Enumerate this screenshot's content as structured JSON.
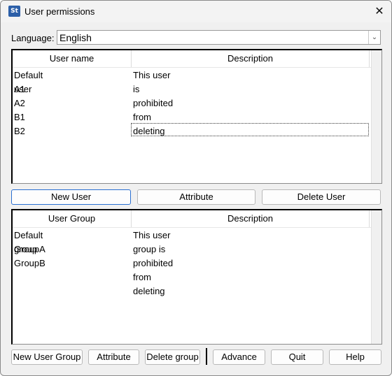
{
  "window": {
    "title": "User permissions",
    "icon_text": "St"
  },
  "language": {
    "label": "Language:",
    "value": "English"
  },
  "users": {
    "columns": [
      "User name",
      "Description"
    ],
    "rows": [
      {
        "name": "Default user",
        "description": "This user is prohibited from deleting"
      },
      {
        "name": "A1",
        "description": ""
      },
      {
        "name": "A2",
        "description": ""
      },
      {
        "name": "B1",
        "description": ""
      },
      {
        "name": "B2",
        "description": ""
      }
    ]
  },
  "user_buttons": {
    "new_user": "New User",
    "attribute": "Attribute",
    "delete_user": "Delete User"
  },
  "groups": {
    "columns": [
      "User Group",
      "Description"
    ],
    "rows": [
      {
        "name": "Default group",
        "description": "This user group is prohibited from deleting"
      },
      {
        "name": "GroupA",
        "description": ""
      },
      {
        "name": "GroupB",
        "description": ""
      }
    ]
  },
  "bottom_buttons": {
    "new_user_group": "New User Group",
    "attribute": "Attribute",
    "delete_group": "Delete group",
    "advance": "Advance",
    "quit": "Quit",
    "help": "Help"
  }
}
